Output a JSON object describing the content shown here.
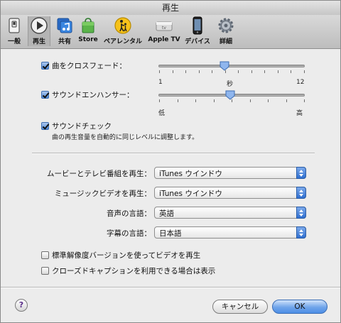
{
  "window": {
    "title": "再生"
  },
  "toolbar": {
    "items": [
      {
        "label": "一般",
        "icon": "switch-icon"
      },
      {
        "label": "再生",
        "icon": "play-icon",
        "selected": true
      },
      {
        "label": "共有",
        "icon": "music-share-icon"
      },
      {
        "label": "Store",
        "icon": "store-bag-icon"
      },
      {
        "label": "ペアレンタル",
        "icon": "parental-icon"
      },
      {
        "label": "Apple TV",
        "icon": "apple-tv-icon"
      },
      {
        "label": "デバイス",
        "icon": "device-icon"
      },
      {
        "label": "詳細",
        "icon": "gear-icon"
      }
    ]
  },
  "crossfade": {
    "label": "曲をクロスフェード：",
    "checked": true,
    "value_seconds": 6,
    "min_label": "1",
    "unit_label": "秒",
    "max_label": "12"
  },
  "enhancer": {
    "label": "サウンドエンハンサー：",
    "checked": true,
    "level_fraction": 0.5,
    "low_label": "低",
    "high_label": "高"
  },
  "soundcheck": {
    "label": "サウンドチェック",
    "checked": true,
    "description": "曲の再生音量を自動的に同じレベルに調整します。"
  },
  "popups": [
    {
      "label": "ムービーとテレビ番組を再生：",
      "value": "iTunes ウインドウ"
    },
    {
      "label": "ミュージックビデオを再生：",
      "value": "iTunes ウインドウ"
    },
    {
      "label": "音声の言語：",
      "value": "英語"
    },
    {
      "label": "字幕の言語：",
      "value": "日本語"
    }
  ],
  "options": [
    {
      "label": "標準解像度バージョンを使ってビデオを再生",
      "checked": false
    },
    {
      "label": "クローズドキャプションを利用できる場合は表示",
      "checked": false
    }
  ],
  "buttons": {
    "help": "?",
    "cancel": "キャンセル",
    "ok": "OK"
  },
  "colors": {
    "accent": "#4d8ee6",
    "window_bg": "#ececec"
  }
}
